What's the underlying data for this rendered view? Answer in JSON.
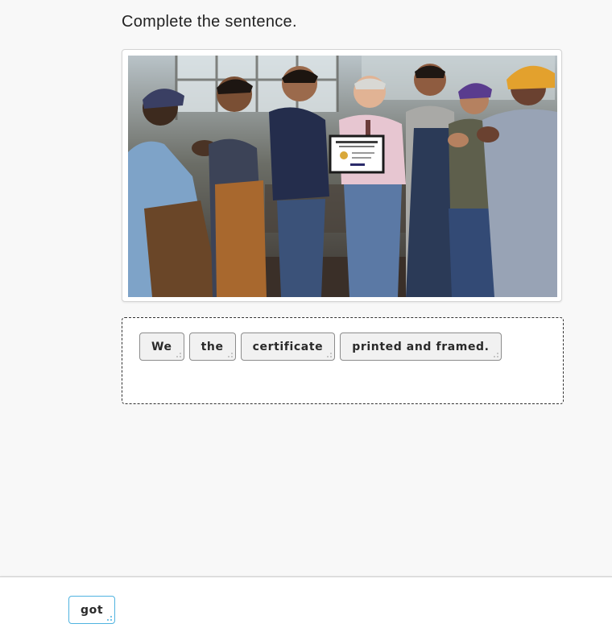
{
  "instruction": "Complete the sentence.",
  "image": {
    "certificate_heading": "Employee of the Month",
    "certificate_subheading": "Certificate of Achievement"
  },
  "answer_tiles": [
    {
      "label": "We"
    },
    {
      "label": "the"
    },
    {
      "label": "certificate"
    },
    {
      "label": "printed and framed."
    }
  ],
  "word_bank": [
    {
      "label": "got"
    }
  ],
  "colors": {
    "page_background": "#f8f8f8",
    "tile_background": "#f1f1f1",
    "bank_tile_border": "#4fb3e0"
  }
}
